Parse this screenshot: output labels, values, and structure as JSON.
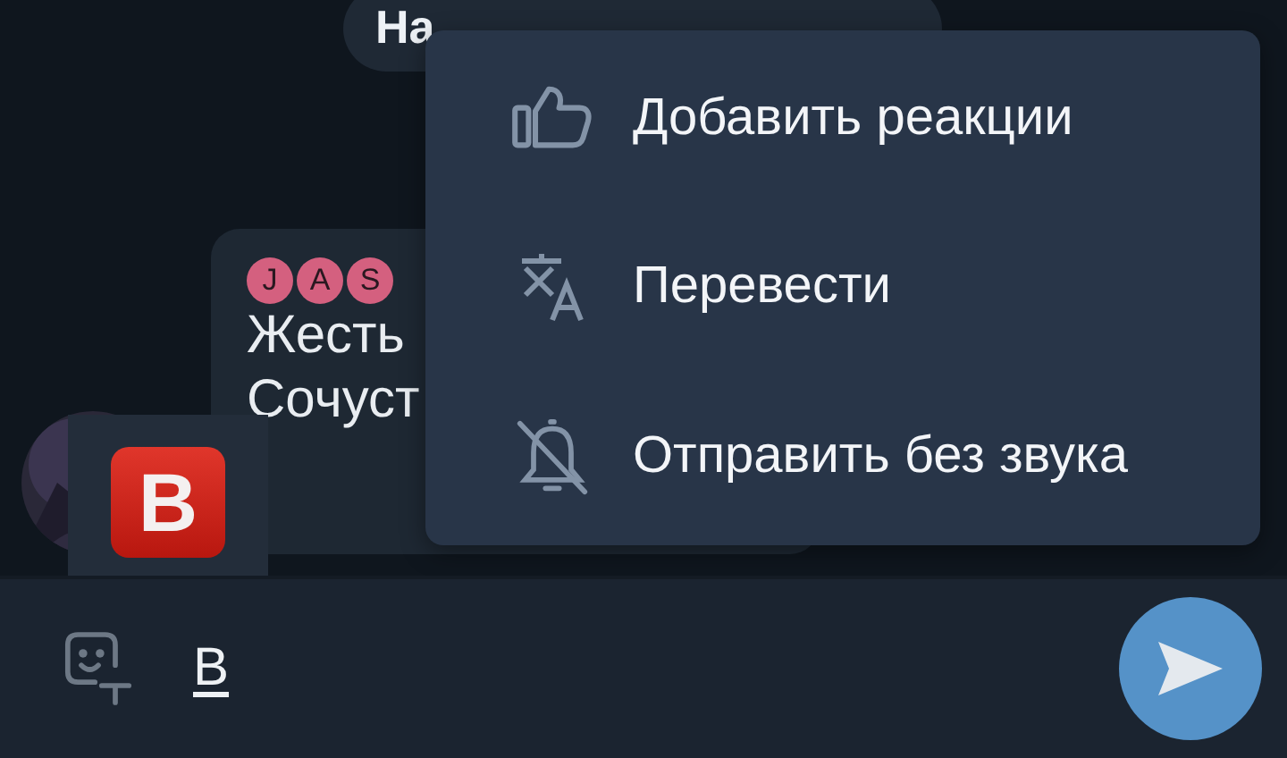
{
  "date_pill": {
    "label": "На"
  },
  "message": {
    "sender_letters": [
      "J",
      "A",
      "S"
    ],
    "lines": [
      "Жесть",
      "Сочуст"
    ],
    "avatar": {
      "kind": "picture"
    }
  },
  "suggestion": {
    "emoji": "B"
  },
  "context_menu": {
    "items": [
      {
        "kind": "reaction",
        "label": "Добавить реакции"
      },
      {
        "kind": "translate",
        "label": "Перевести"
      },
      {
        "kind": "silent",
        "label": "Отправить без звука"
      }
    ]
  },
  "composer": {
    "value": "B"
  }
}
